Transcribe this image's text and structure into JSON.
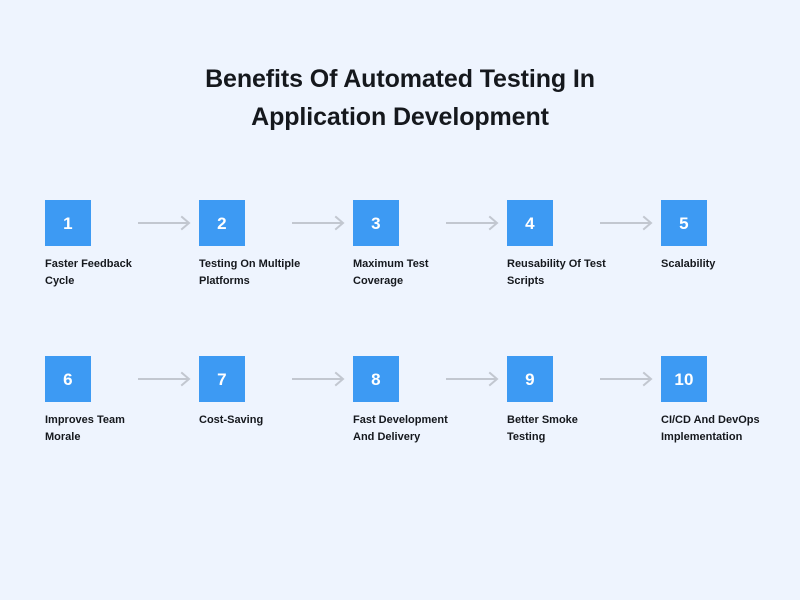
{
  "title": {
    "line1": "Benefits Of Automated Testing In",
    "line2": "Application Development"
  },
  "colors": {
    "background": "#eef4fe",
    "box": "#3d9af3",
    "number": "#ffffff",
    "label": "#15181d",
    "arrow": "#c2c7d0"
  },
  "rows": [
    {
      "steps": [
        {
          "number": "1",
          "label": "Faster Feedback\nCycle"
        },
        {
          "number": "2",
          "label": "Testing On Multiple\nPlatforms"
        },
        {
          "number": "3",
          "label": "Maximum Test\nCoverage"
        },
        {
          "number": "4",
          "label": "Reusability Of Test\nScripts"
        },
        {
          "number": "5",
          "label": "Scalability"
        }
      ]
    },
    {
      "steps": [
        {
          "number": "6",
          "label": "Improves Team\nMorale"
        },
        {
          "number": "7",
          "label": "Cost-Saving"
        },
        {
          "number": "8",
          "label": "Fast Development\nAnd Delivery"
        },
        {
          "number": "9",
          "label": "Better Smoke\nTesting"
        },
        {
          "number": "10",
          "label": "CI/CD And DevOps\nImplementation"
        }
      ]
    }
  ]
}
